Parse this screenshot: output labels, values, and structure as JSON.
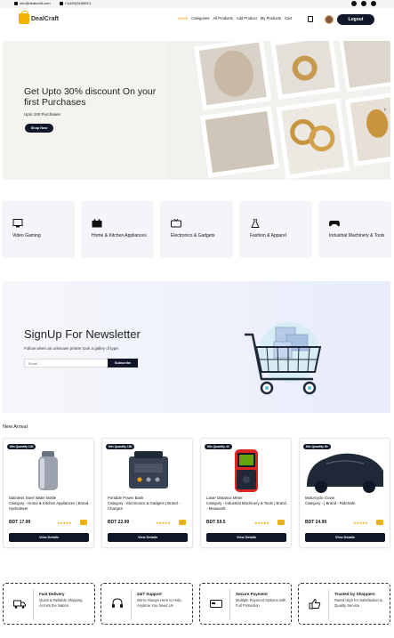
{
  "topbar": {
    "email": "info@dealcraft.com",
    "phone": "+1(404)3185613",
    "social": [
      "facebook-icon",
      "instagram-icon",
      "envelope-icon"
    ]
  },
  "header": {
    "brand": "DealCraft",
    "nav": [
      "Home",
      "Categories",
      "All Products",
      "Add Product",
      "My Products",
      "Cart"
    ],
    "active_nav": "Home",
    "logout_label": "Logout"
  },
  "hero": {
    "title": "Get Upto 30% discount On your first Purchases",
    "subtitle": "Upto 100 Purchases",
    "button_label": "Shop Now"
  },
  "categories": [
    {
      "label": "Video Gaming",
      "icon": "monitor-icon"
    },
    {
      "label": "Home & Kitchen Appliances",
      "icon": "stove-icon"
    },
    {
      "label": "Electronics & Gadgets",
      "icon": "tv-icon"
    },
    {
      "label": "Fashion & Apparel",
      "icon": "dress-icon"
    },
    {
      "label": "Industrial Machinery & Tools",
      "icon": "gamepad-icon"
    }
  ],
  "newsletter": {
    "title": "SignUp For Newsletter",
    "subtitle": "Follow when an unknown printer took a galley of type.",
    "input_placeholder": "Email",
    "button_label": "Subscribe"
  },
  "new_arrival": {
    "title": "New Arrival",
    "products": [
      {
        "min_qty": "Min Quantity 120",
        "name": "Stainless Steel Water Bottle",
        "category": "Category - Home & Kitchen Appliances | Brand - HydroSteel",
        "price": "BDT 17.99",
        "stars": "★★★★★",
        "button": "View Details"
      },
      {
        "min_qty": "Min Quantity 150",
        "name": "Portable Power Bank",
        "category": "Category - Electronics & Gadgets | Brand - ChargeX",
        "price": "BDT 22.99",
        "stars": "★★★★★",
        "button": "View Details"
      },
      {
        "min_qty": "Min Quantity 40",
        "name": "Laser Distance Meter",
        "category": "Category - Industrial Machinery & Tools | Brand - Measurelt",
        "price": "BDT 59.5",
        "stars": "★★★★★",
        "button": "View Details"
      },
      {
        "min_qty": "Min Quantity 80",
        "name": "Motorcycle Cover",
        "category": "Category - | Brand - RideSafe",
        "price": "BDT 24.99",
        "stars": "★★★★★",
        "button": "View Details"
      }
    ]
  },
  "features": [
    {
      "title": "Fast Delivery",
      "desc": "Quick & Reliable Shipping Across the Nation",
      "icon": "truck-icon"
    },
    {
      "title": "24/7 Support",
      "desc": "We're Always Here to Help, Anytime You Need Us",
      "icon": "headset-icon"
    },
    {
      "title": "Secure Payment",
      "desc": "Multiple Payment Options with Full Protection",
      "icon": "card-icon"
    },
    {
      "title": "Trusted by Shoppers",
      "desc": "Rated High for Satisfaction & Quality Service",
      "icon": "thumbs-up-icon"
    }
  ]
}
